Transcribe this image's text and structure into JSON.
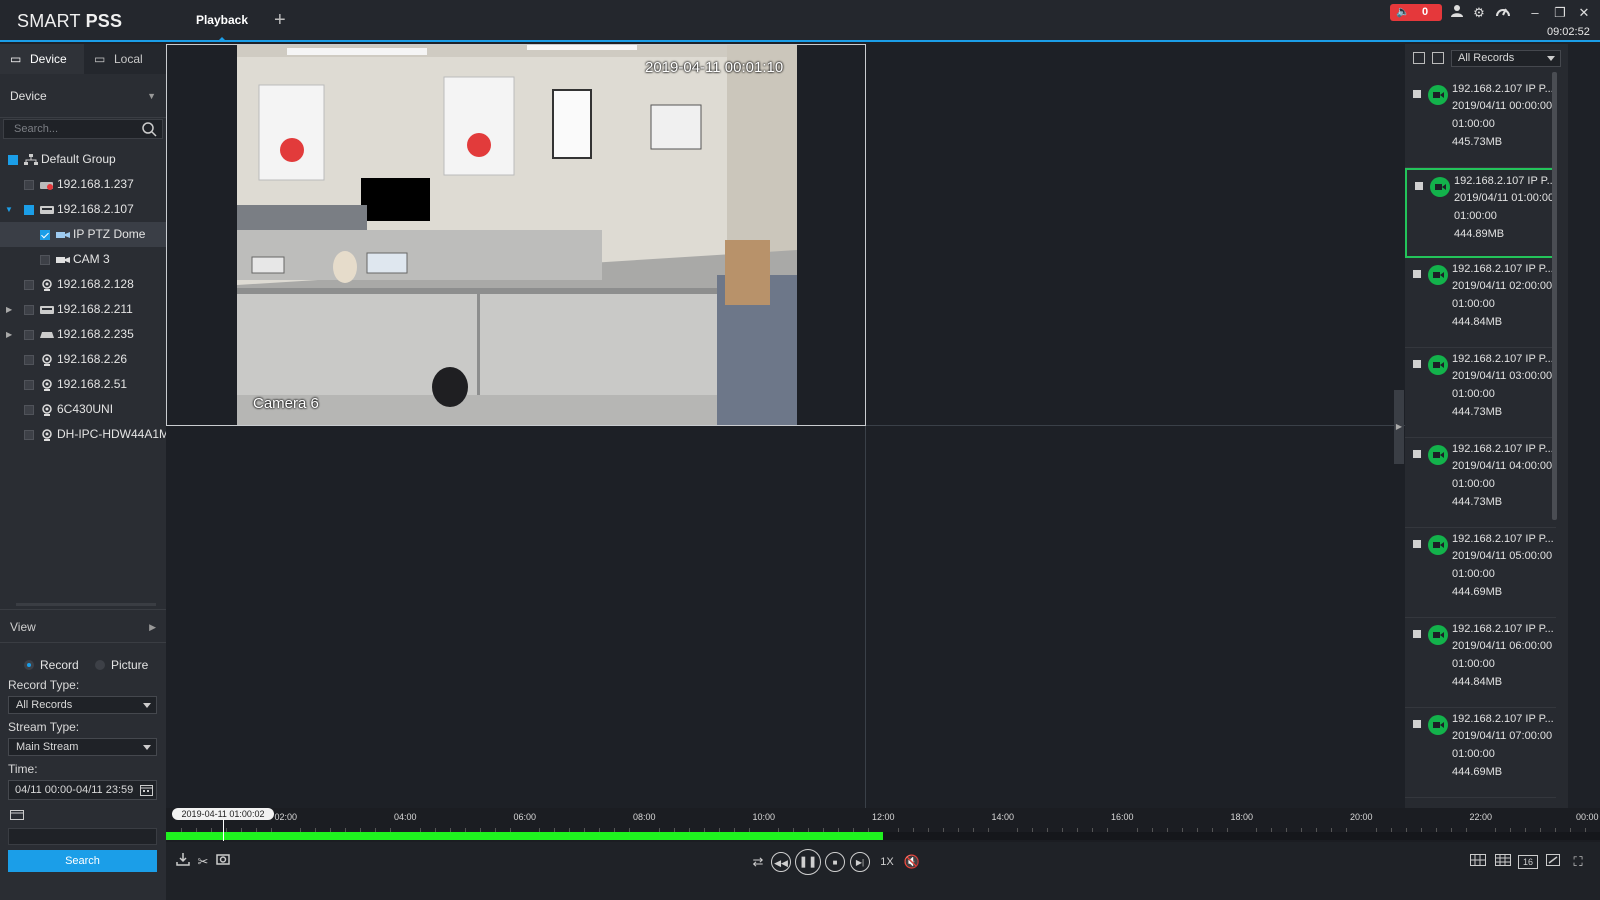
{
  "app": {
    "logo_light": "SMART ",
    "logo_bold": "PSS",
    "tab": "Playback",
    "alarm_count": "0",
    "clock": "09:02:52"
  },
  "left_panel": {
    "tabs": [
      "Device",
      "Local"
    ],
    "device_dropdown": "Device",
    "search_placeholder": "Search...",
    "tree": [
      {
        "label": "Default Group"
      },
      {
        "label": "192.168.1.237"
      },
      {
        "label": "192.168.2.107"
      },
      {
        "label": "IP PTZ Dome"
      },
      {
        "label": "CAM 3"
      },
      {
        "label": "192.168.2.128"
      },
      {
        "label": "192.168.2.211"
      },
      {
        "label": "192.168.2.235"
      },
      {
        "label": "192.168.2.26"
      },
      {
        "label": "192.168.2.51"
      },
      {
        "label": "6C430UNI"
      },
      {
        "label": "DH-IPC-HDW44A1M..."
      }
    ],
    "view_label": "View",
    "radio_record": "Record",
    "radio_picture": "Picture",
    "record_type_label": "Record Type:",
    "record_type_value": "All Records",
    "stream_type_label": "Stream Type:",
    "stream_type_value": "Main Stream",
    "time_label": "Time:",
    "time_value": "04/11 00:00-04/11 23:59",
    "search_button": "Search"
  },
  "video": {
    "osd_time": "2019-04-11 00:01:10",
    "osd_name": "Camera 6"
  },
  "right_panel": {
    "filter": "All Records",
    "records": [
      {
        "name": "192.168.2.107 IP P...",
        "start": "2019/04/11 00:00:00",
        "duration": "01:00:00",
        "size": "445.73MB"
      },
      {
        "name": "192.168.2.107 IP P...",
        "start": "2019/04/11 01:00:00",
        "duration": "01:00:00",
        "size": "444.89MB"
      },
      {
        "name": "192.168.2.107 IP P...",
        "start": "2019/04/11 02:00:00",
        "duration": "01:00:00",
        "size": "444.84MB"
      },
      {
        "name": "192.168.2.107 IP P...",
        "start": "2019/04/11 03:00:00",
        "duration": "01:00:00",
        "size": "444.73MB"
      },
      {
        "name": "192.168.2.107 IP P...",
        "start": "2019/04/11 04:00:00",
        "duration": "01:00:00",
        "size": "444.73MB"
      },
      {
        "name": "192.168.2.107 IP P...",
        "start": "2019/04/11 05:00:00",
        "duration": "01:00:00",
        "size": "444.69MB"
      },
      {
        "name": "192.168.2.107 IP P...",
        "start": "2019/04/11 06:00:00",
        "duration": "01:00:00",
        "size": "444.84MB"
      },
      {
        "name": "192.168.2.107 IP P...",
        "start": "2019/04/11 07:00:00",
        "duration": "01:00:00",
        "size": "444.69MB"
      }
    ]
  },
  "timeline": {
    "cursor": "2019-04-11 01:00:02",
    "ticks": [
      "02:00",
      "04:00",
      "06:00",
      "08:00",
      "10:00",
      "12:00",
      "14:00",
      "16:00",
      "18:00",
      "20:00",
      "22:00",
      "00:00"
    ],
    "recorded_until": "12:00",
    "record_color": "#1ff21f"
  },
  "toolbar": {
    "speed": "1X",
    "split_16": "16"
  }
}
